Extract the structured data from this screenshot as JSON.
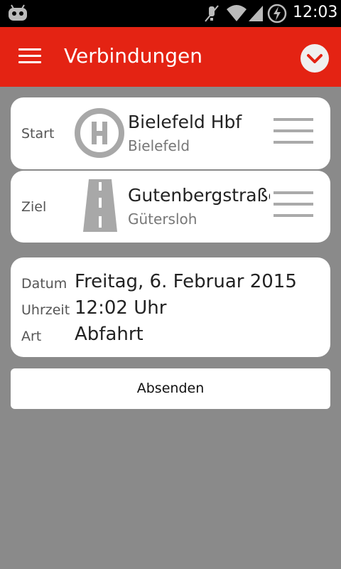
{
  "status_bar": {
    "time": "12:03",
    "icons": [
      "cyanogenmod-icon",
      "mute-icon",
      "wifi-icon",
      "signal-icon",
      "battery-charging-icon"
    ]
  },
  "app_bar": {
    "title": "Verbindungen",
    "menu_icon": "hamburger-menu-icon",
    "overflow_icon": "chevron-down-icon",
    "color": "#e42313"
  },
  "start": {
    "label": "Start",
    "icon": "bus-stop-icon",
    "name": "Bielefeld Hbf",
    "city": "Bielefeld"
  },
  "ziel": {
    "label": "Ziel",
    "icon": "road-icon",
    "name": "Gutenbergstraße",
    "city": "Gütersloh"
  },
  "details": {
    "datum_label": "Datum",
    "datum_value": "Freitag, 6. Februar 2015",
    "uhrzeit_label": "Uhrzeit",
    "uhrzeit_value": "12:02 Uhr",
    "art_label": "Art",
    "art_value": "Abfahrt"
  },
  "submit": {
    "label": "Absenden"
  }
}
